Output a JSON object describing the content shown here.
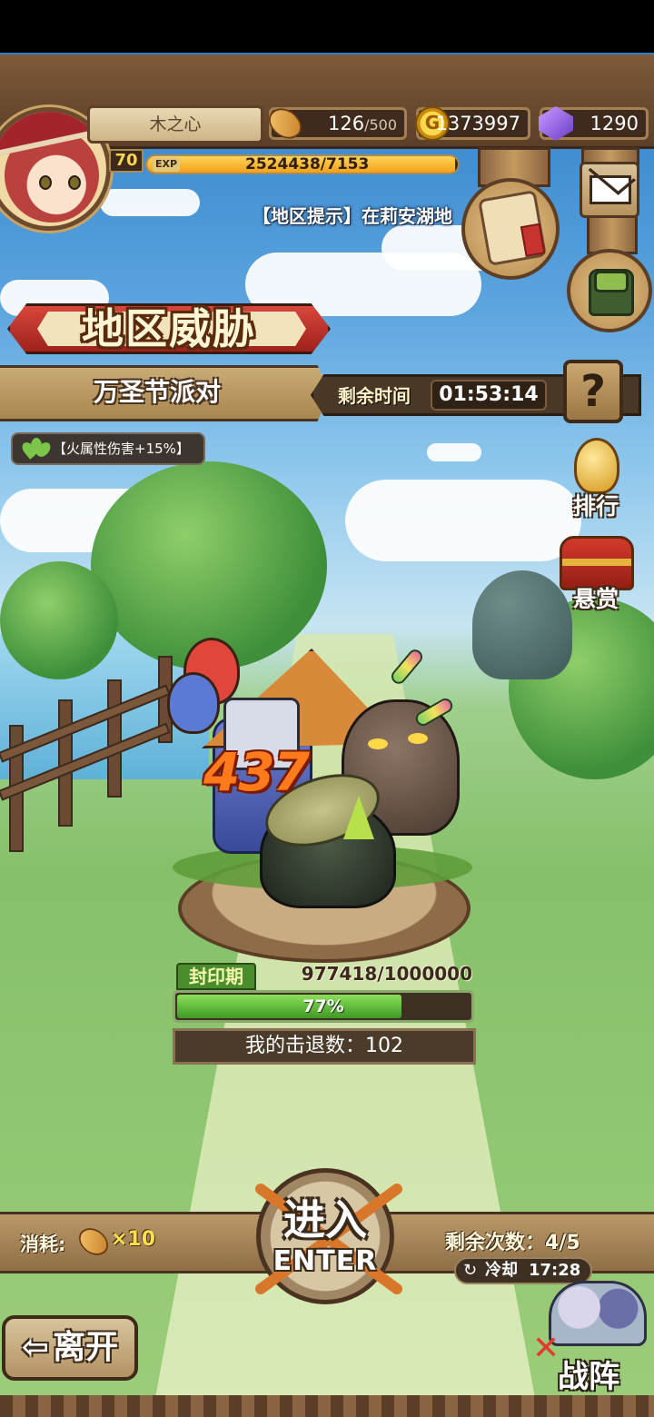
{
  "player": {
    "name": "木之心",
    "level": "70",
    "exp_label": "EXP",
    "exp_text": "2524438/7153",
    "exp_fraction": 0.99
  },
  "resources": {
    "stamina_current": "126",
    "stamina_cap": "/500",
    "gold": "1373997",
    "gold_icon_letter": "G",
    "gems": "1290"
  },
  "area_hint": "【地区提示】在莉安湖地",
  "event": {
    "banner_title": "地区威胁",
    "name": "万圣节派对",
    "time_label": "剩余时间",
    "time_value": "01:53:14",
    "help_icon": "?",
    "buff": "【火属性伤害+15%】"
  },
  "side_buttons": {
    "ranking_label": "排行",
    "bounty_label": "悬赏"
  },
  "boss": {
    "damage_number": "437",
    "status_tag": "封印期",
    "hp_text": "977418/1000000",
    "hp_percent_label": "77%",
    "hp_fraction": 0.77,
    "my_kills": "我的击退数：102"
  },
  "entry": {
    "cost_label": "消耗:",
    "cost_value": "×10",
    "enter_cn": "进入",
    "enter_en": "ENTER",
    "remaining": "剩余次数：4/5",
    "cooldown_label": "冷却",
    "cooldown_value": "17:28"
  },
  "nav": {
    "leave_label": "离开",
    "team_label": "战阵"
  },
  "icons": {
    "stamina": "bread-icon",
    "gold": "gold-coin-icon",
    "gem": "purple-gem-icon",
    "scroll": "quest-scroll-icon",
    "mail": "mail-icon",
    "bag": "backpack-icon",
    "buff": "leaf-icon",
    "ranking": "trophy-egg-icon",
    "bounty": "treasure-chest-icon",
    "cooldown": "refresh-icon"
  },
  "colors": {
    "accent_red": "#c7332f",
    "hp_green": "#3f9a24",
    "exp_gold": "#f1a21a",
    "damage_orange": "#ff7a1a"
  }
}
